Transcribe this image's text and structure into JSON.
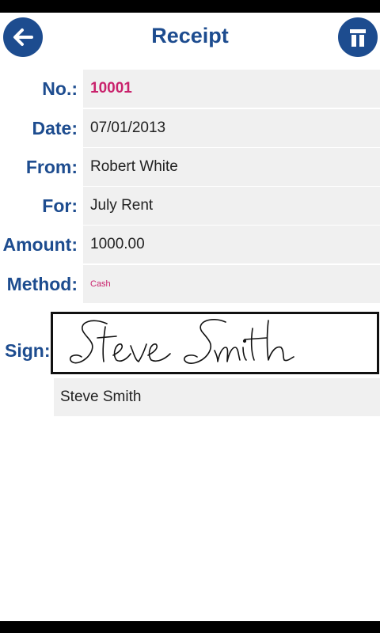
{
  "header": {
    "title": "Receipt",
    "back_icon": "arrow-left-icon",
    "delete_icon": "trash-icon",
    "accent_color": "#1d4c8f"
  },
  "fields": {
    "number": {
      "label": "No.:",
      "value": "10001"
    },
    "date": {
      "label": "Date:",
      "value": "07/01/2013"
    },
    "from": {
      "label": "From:",
      "value": "Robert White"
    },
    "for": {
      "label": "For:",
      "value": "July Rent"
    },
    "amount": {
      "label": "Amount:",
      "value": "1000.00"
    },
    "method": {
      "label": "Method:",
      "value": "Cash"
    }
  },
  "signature": {
    "label": "Sign:",
    "handwritten": "Steve Smith",
    "signer_name": "Steve Smith"
  },
  "colors": {
    "label": "#1d4c8f",
    "highlight_value": "#c9226c",
    "field_background": "#f0f0f0"
  }
}
